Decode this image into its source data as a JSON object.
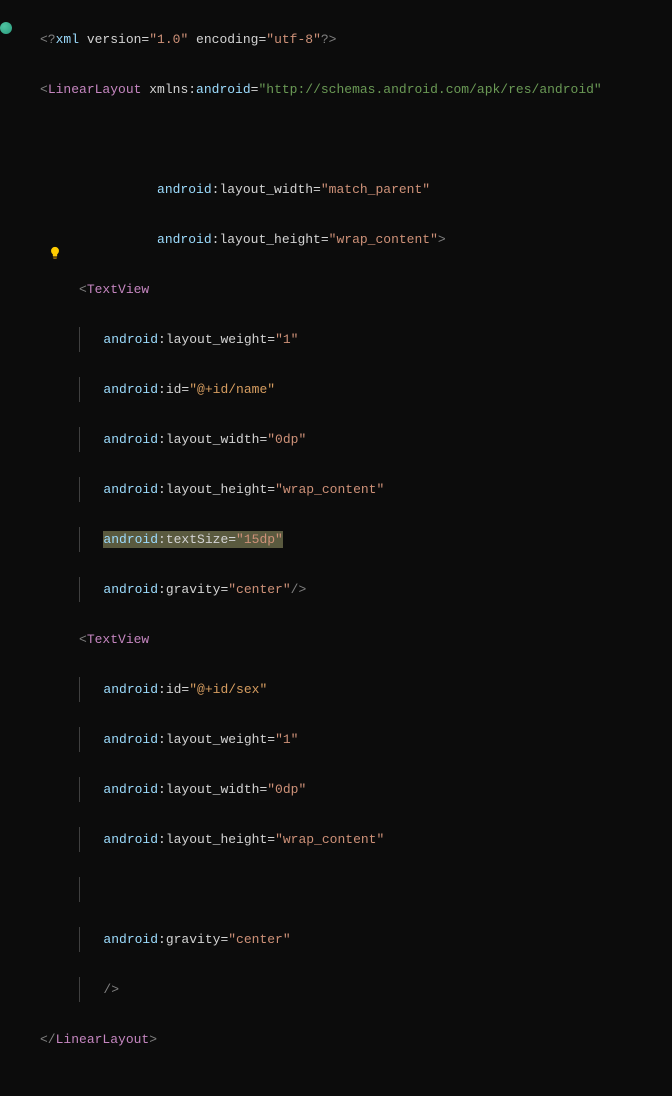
{
  "xml_decl": {
    "open": "<?",
    "name": "xml",
    "version_attr": " version=",
    "version_val": "\"1.0\"",
    "encoding_attr": " encoding=",
    "encoding_val": "\"utf-8\"",
    "close": "?>"
  },
  "root": {
    "open": "<",
    "name": "LinearLayout",
    "ns_attr": " xmlns:",
    "ns_key": "android",
    "eq": "=",
    "ns_val": "\"http://schemas.android.com/apk/res/android\"",
    "lw_attr": "android",
    "lw_key": ":layout_width=",
    "lw_val": "\"match_parent\"",
    "lh_attr": "android",
    "lh_key": ":layout_height=",
    "lh_val": "\"wrap_content\"",
    "end": ">",
    "close_open": "</",
    "close_name": "LinearLayout",
    "close_end": ">"
  },
  "tv1": {
    "open": "<",
    "name": "TextView",
    "a1_ns": "android",
    "a1_k": ":layout_weight=",
    "a1_v": "\"1\"",
    "a2_ns": "android",
    "a2_k": ":id=",
    "a2_v": "\"@+id/name\"",
    "a3_ns": "android",
    "a3_k": ":layout_width=",
    "a3_v": "\"0dp\"",
    "a4_ns": "android",
    "a4_k": ":layout_height=",
    "a4_v": "\"wrap_content\"",
    "a5_ns": "android",
    "a5_k": ":textSize=",
    "a5_v": "\"15dp\"",
    "a6_ns": "android",
    "a6_k": ":gravity=",
    "a6_v": "\"center\"",
    "close": "/>"
  },
  "tv2": {
    "open": "<",
    "name": "TextView",
    "a1_ns": "android",
    "a1_k": ":id=",
    "a1_v": "\"@+id/sex\"",
    "a2_ns": "android",
    "a2_k": ":layout_weight=",
    "a2_v": "\"1\"",
    "a3_ns": "android",
    "a3_k": ":layout_width=",
    "a3_v": "\"0dp\"",
    "a4_ns": "android",
    "a4_k": ":layout_height=",
    "a4_v": "\"wrap_content\"",
    "a5_ns": "android",
    "a5_k": ":gravity=",
    "a5_v": "\"center\"",
    "close": "/>"
  }
}
